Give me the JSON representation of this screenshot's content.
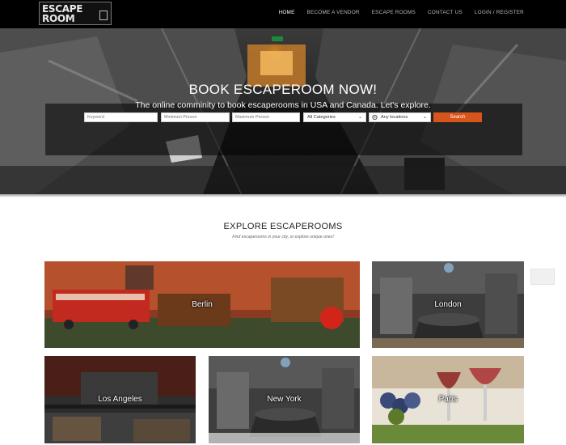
{
  "logo": {
    "line1": "ESCAPE",
    "line2": "ROOM"
  },
  "nav": [
    {
      "label": "HOME",
      "active": true
    },
    {
      "label": "BECOME A VENDOR",
      "active": false
    },
    {
      "label": "ESCAPE ROOMS",
      "active": false
    },
    {
      "label": "CONTACT US",
      "active": false
    },
    {
      "label": "LOGIN / REGISTER",
      "active": false
    }
  ],
  "hero": {
    "title": "BOOK ESCAPEROOM NOW!",
    "subtitle": "The online comminity to book escaperooms in USA and Canada. Let's explore.",
    "search": {
      "keyword_placeholder": "Keyword",
      "min_placeholder": "Minimum Person",
      "max_placeholder": "Maximum Person",
      "category_value": "All Categories",
      "location_value": "Any locations",
      "button_label": "Search"
    }
  },
  "explore": {
    "title": "EXPLORE ESCAPEROOMS",
    "subtitle": "Find escaperooms in your city, or explore unique ones!"
  },
  "cities": [
    {
      "name": "Berlin"
    },
    {
      "name": "London"
    },
    {
      "name": "Los Angeles"
    },
    {
      "name": "New York"
    },
    {
      "name": "Paris"
    }
  ],
  "colors": {
    "accent": "#d7541b",
    "nav_bg": "#000000"
  }
}
